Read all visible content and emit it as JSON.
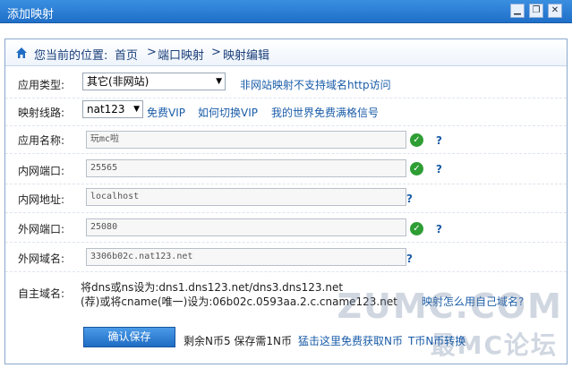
{
  "window": {
    "title": "添加映射",
    "min_label": "▁",
    "restore_label": "❐",
    "close_label": "✕"
  },
  "breadcrumb": {
    "prefix": "您当前的位置:",
    "home": "首页",
    "sep": ">",
    "item1": "端口映射",
    "item2": "映射编辑"
  },
  "form": {
    "app_type": {
      "label": "应用类型:",
      "value": "其它(非网站)",
      "note": "非网站映射不支持域名http访问"
    },
    "line": {
      "label": "映射线路:",
      "value": "nat123",
      "link1": "免费VIP",
      "link2": "如何切换VIP",
      "link3": "我的世界免费满格信号"
    },
    "app_name": {
      "label": "应用名称:",
      "value": "玩mc啦"
    },
    "lan_port": {
      "label": "内网端口:",
      "value": "25565"
    },
    "lan_addr": {
      "label": "内网地址:",
      "value": "localhost"
    },
    "wan_port": {
      "label": "外网端口:",
      "value": "25080"
    },
    "wan_domain": {
      "label": "外网域名:",
      "value": "3306b02c.nat123.net"
    },
    "own_domain": {
      "label": "自主域名:",
      "line1": "将dns或ns设为:dns1.dns123.net/dns3.dns123.net",
      "line2": "(荐)或将cname(唯一)设为:06b02c.0593aa.2.c.cname123.net",
      "help": "映射怎么用自己域名?"
    },
    "help_mark": "?"
  },
  "footer": {
    "save": "确认保存",
    "balance": "剩余N币5 保存需1N币",
    "free_link": "猛击这里免费获取N币",
    "convert_link": "T币N币转换"
  },
  "watermark": {
    "line1": "ZUMC.COM",
    "line2": "最MC论坛"
  }
}
